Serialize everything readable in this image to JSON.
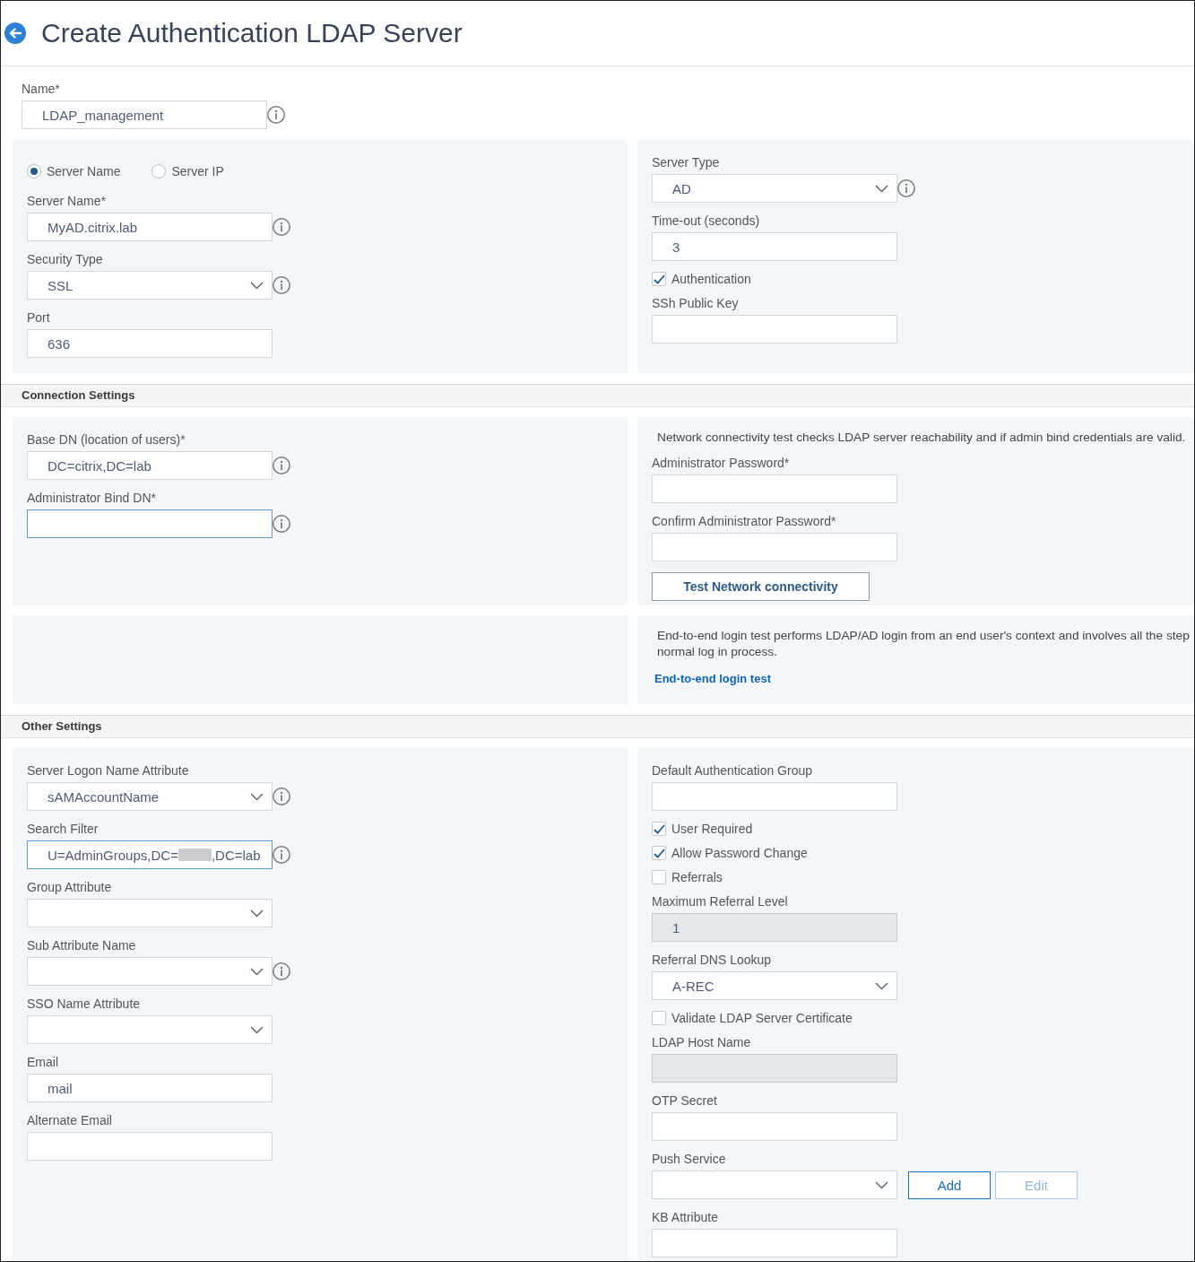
{
  "header": {
    "title": "Create Authentication LDAP Server"
  },
  "name_field": {
    "kind": "input",
    "label": "Name*",
    "value": "LDAP_management",
    "info": true,
    "focused": false,
    "disabled": false
  },
  "sections": [
    {
      "rows": [
        {
          "left": {
            "items": [
              {
                "kind": "radio",
                "options": [
                  {
                    "label": "Server Name",
                    "selected": true
                  },
                  {
                    "label": "Server IP",
                    "selected": false
                  }
                ]
              },
              {
                "kind": "input",
                "label": "Server Name*",
                "value": "MyAD.citrix.lab",
                "info": true,
                "focused": false,
                "disabled": false
              },
              {
                "kind": "select",
                "label": "Security Type",
                "value": "SSL",
                "info": true,
                "focused": false,
                "disabled": false
              },
              {
                "kind": "input",
                "label": "Port",
                "value": "636",
                "info": false,
                "focused": false,
                "disabled": false
              }
            ]
          },
          "right": {
            "items": [
              {
                "kind": "select",
                "label": "Server Type",
                "value": "AD",
                "info": true,
                "focused": false,
                "disabled": false
              },
              {
                "kind": "input",
                "label": "Time-out (seconds)",
                "value": "3",
                "info": false,
                "focused": false,
                "disabled": false
              },
              {
                "kind": "checkbox",
                "label": "Authentication",
                "checked": true
              },
              {
                "kind": "input",
                "label": "SSh Public Key",
                "info": false,
                "focused": false,
                "disabled": false
              }
            ]
          }
        }
      ]
    },
    {
      "heading": "Connection Settings",
      "rows": [
        {
          "left": {
            "items": [
              {
                "kind": "input",
                "label": "Base DN (location of users)*",
                "value": "DC=citrix,DC=lab",
                "info": true,
                "focused": false,
                "disabled": false
              },
              {
                "kind": "input",
                "label": "Administrator Bind DN*",
                "info": true,
                "focused": true,
                "disabled": false
              }
            ]
          },
          "right": {
            "items": [
              {
                "kind": "note",
                "lines": [
                  "Network connectivity test checks LDAP server reachability and if admin bind credentials are valid."
                ]
              },
              {
                "kind": "input",
                "label": "Administrator Password*",
                "info": false,
                "focused": false,
                "disabled": false
              },
              {
                "kind": "input",
                "label": "Confirm Administrator Password*",
                "info": false,
                "focused": false,
                "disabled": false
              },
              {
                "kind": "button",
                "label": "Test Network connectivity"
              }
            ]
          }
        },
        {
          "left": {},
          "right": {
            "items": [
              {
                "kind": "note",
                "lines": [
                  "End-to-end login test performs LDAP/AD login from an end user's context and involves all the step",
                  "normal log in process."
                ]
              },
              {
                "kind": "link",
                "label": "End-to-end login test"
              }
            ]
          }
        }
      ]
    },
    {
      "heading": "Other Settings",
      "rows": [
        {
          "left": {
            "items": [
              {
                "kind": "select",
                "label": "Server Logon Name Attribute",
                "value": "sAMAccountName",
                "info": true,
                "focused": false,
                "disabled": false
              },
              {
                "kind": "input",
                "label": "Search Filter",
                "value": "U=AdminGroups,DC=",
                "redacted": true,
                "value_end": ",DC=lab",
                "info": true,
                "focused": true,
                "disabled": false
              },
              {
                "kind": "select",
                "label": "Group Attribute",
                "info": false,
                "focused": false,
                "disabled": false
              },
              {
                "kind": "select",
                "label": "Sub Attribute Name",
                "info": true,
                "focused": false,
                "disabled": false
              },
              {
                "kind": "select",
                "label": "SSO Name Attribute",
                "info": false,
                "focused": false,
                "disabled": false
              },
              {
                "kind": "input",
                "label": "Email",
                "value": "mail",
                "info": false,
                "focused": false,
                "disabled": false
              },
              {
                "kind": "input",
                "label": "Alternate Email",
                "info": false,
                "focused": false,
                "disabled": false
              }
            ]
          },
          "right": {
            "items": [
              {
                "kind": "input",
                "label": "Default Authentication Group",
                "info": false,
                "focused": false,
                "disabled": false
              },
              {
                "kind": "checkbox",
                "label": "User Required",
                "checked": true
              },
              {
                "kind": "checkbox",
                "label": "Allow Password Change",
                "checked": true
              },
              {
                "kind": "checkbox",
                "label": "Referrals",
                "checked": false
              },
              {
                "kind": "input",
                "label": "Maximum Referral Level",
                "value": "1",
                "info": false,
                "focused": false,
                "disabled": true
              },
              {
                "kind": "select",
                "label": "Referral DNS Lookup",
                "value": "A-REC",
                "info": false,
                "focused": false,
                "disabled": false
              },
              {
                "kind": "checkbox",
                "label": "Validate LDAP Server Certificate",
                "checked": false
              },
              {
                "kind": "input",
                "label": "LDAP Host Name",
                "info": false,
                "focused": false,
                "disabled": true
              },
              {
                "kind": "input",
                "label": "OTP Secret",
                "info": false,
                "focused": false,
                "disabled": false
              },
              {
                "kind": "select",
                "label": "Push Service",
                "info": false,
                "focused": false,
                "disabled": false,
                "buttons": [
                  {
                    "label": "Add",
                    "disabled": false
                  },
                  {
                    "label": "Edit",
                    "disabled": true
                  }
                ]
              },
              {
                "kind": "input",
                "label": "KB Attribute",
                "info": false,
                "focused": false,
                "disabled": false
              }
            ]
          }
        }
      ]
    }
  ]
}
